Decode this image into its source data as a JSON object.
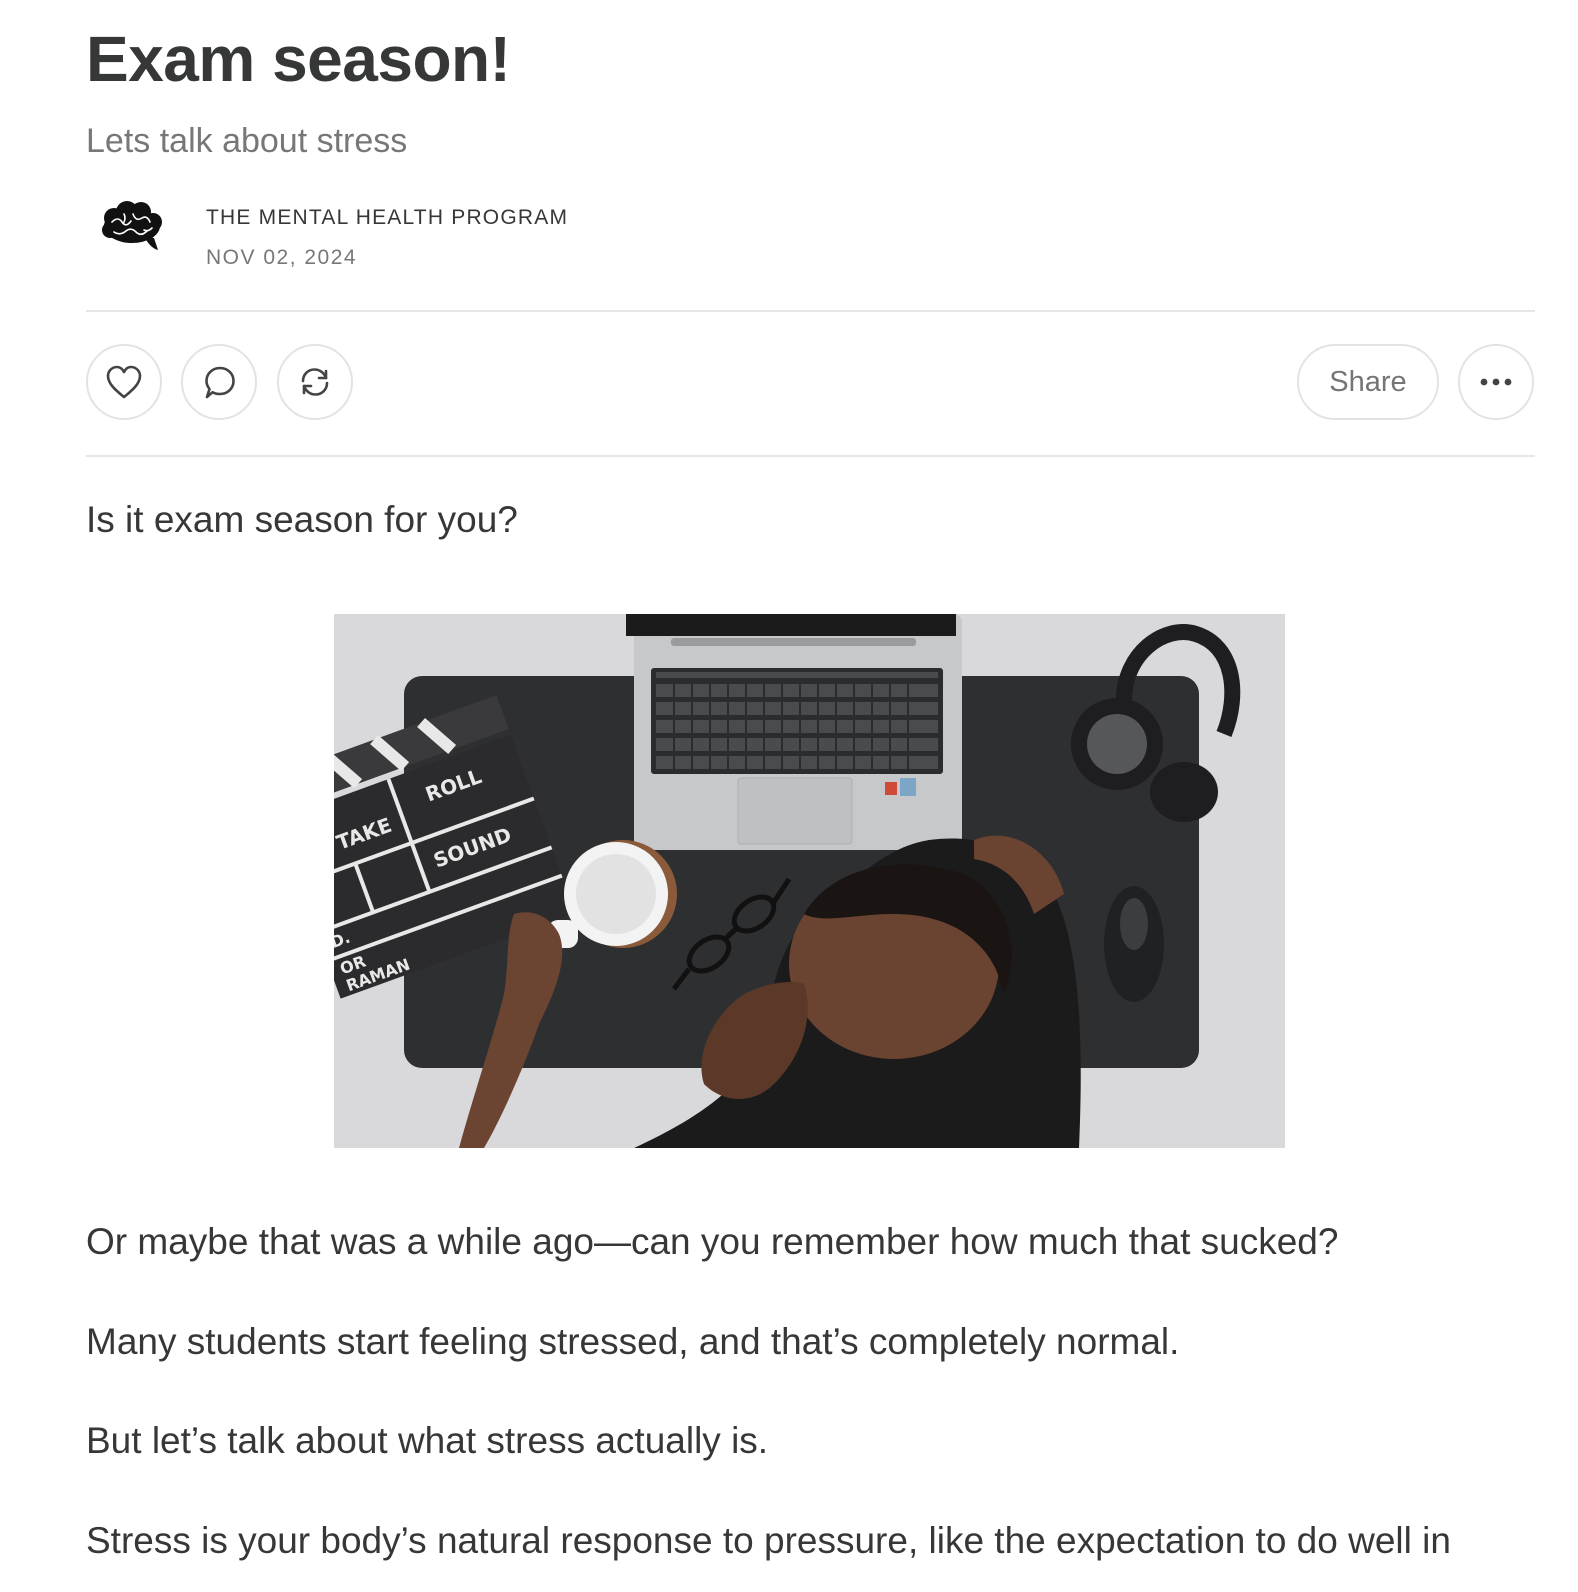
{
  "post": {
    "title": "Exam season!",
    "subtitle": "Lets talk about stress",
    "publication": "THE MENTAL HEALTH PROGRAM",
    "date": "NOV 02, 2024",
    "avatar_icon": "brain-icon"
  },
  "actions": {
    "like_icon": "heart-icon",
    "comment_icon": "comment-bubble-icon",
    "restack_icon": "restack-arrows-icon",
    "share_label": "Share",
    "more_icon": "ellipsis-icon"
  },
  "body": {
    "intro": "Is it exam season for you?",
    "paragraphs": [
      "Or maybe that was a while ago—can you remember how much that sucked?",
      "Many students start feeling stressed, and that’s completely normal.",
      "But let’s talk about what stress actually is.",
      "Stress is your body’s natural response to pressure, like the expectation to do well in"
    ]
  },
  "hero_image": {
    "subject": "student asleep on desk with laptop, headphones, mouse, clapperboard, mug and glasses",
    "clapperboard_text": [
      "ROLL",
      "TAKE",
      "SOUND",
      "D.",
      "OR",
      "RAMAN"
    ]
  },
  "colors": {
    "text": "#363737",
    "muted": "#777777",
    "border": "#e3e3e3"
  }
}
